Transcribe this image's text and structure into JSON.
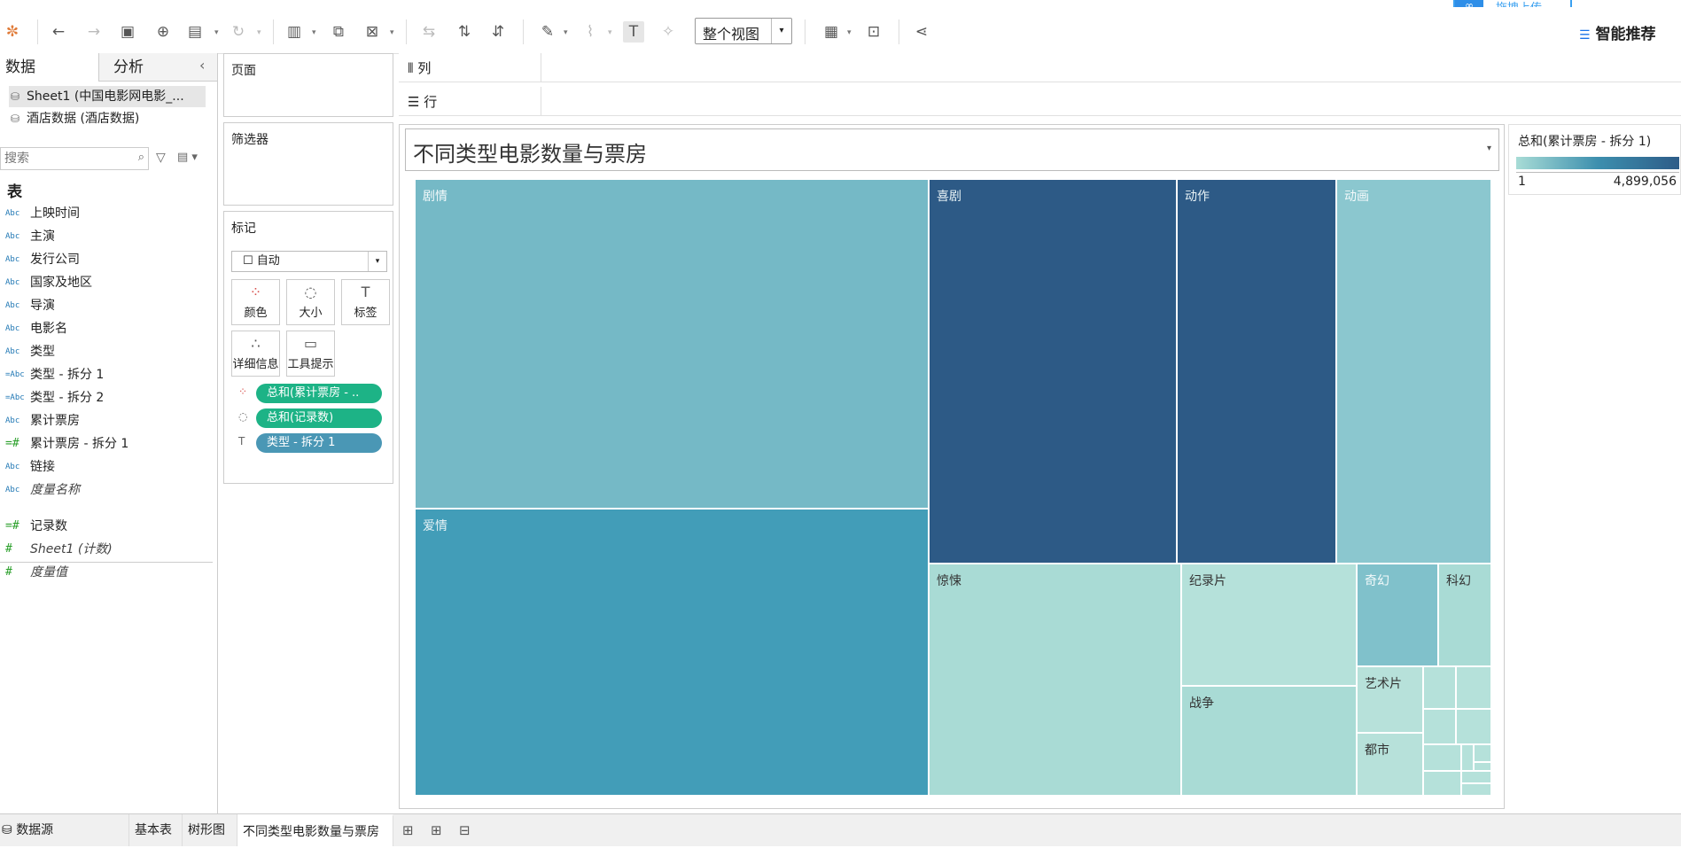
{
  "topbar": {
    "upload_label": "拖拽上传",
    "smart_recommend": "智能推荐",
    "view_select": "整个视图"
  },
  "left_pane": {
    "tab_data": "数据",
    "tab_analysis": "分析",
    "datasources": [
      "Sheet1 (中国电影网电影_...",
      "酒店数据 (酒店数据)"
    ],
    "search_placeholder": "搜索",
    "table_heading": "表",
    "dimensions": [
      {
        "type": "Abc",
        "name": "上映时间"
      },
      {
        "type": "Abc",
        "name": "主演"
      },
      {
        "type": "Abc",
        "name": "发行公司"
      },
      {
        "type": "Abc",
        "name": "国家及地区"
      },
      {
        "type": "Abc",
        "name": "导演"
      },
      {
        "type": "Abc",
        "name": "电影名"
      },
      {
        "type": "Abc",
        "name": "类型"
      },
      {
        "type": "=Abc",
        "name": "类型 - 拆分 1"
      },
      {
        "type": "=Abc",
        "name": "类型 - 拆分 2"
      },
      {
        "type": "Abc",
        "name": "累计票房"
      },
      {
        "type": "=#",
        "name": "累计票房 - 拆分 1"
      },
      {
        "type": "Abc",
        "name": "链接"
      },
      {
        "type": "Abc",
        "name": "度量名称"
      }
    ],
    "measures": [
      {
        "type": "=#",
        "name": "记录数"
      },
      {
        "type": "#",
        "name": "Sheet1 (计数)"
      },
      {
        "type": "#",
        "name": "度量值"
      }
    ]
  },
  "shelves": {
    "pages": "页面",
    "filters": "筛选器",
    "marks": "标记",
    "mark_type": "自动",
    "columns": "列",
    "rows": "行"
  },
  "mark_buttons": [
    {
      "label": "颜色",
      "icon": "color-icon"
    },
    {
      "label": "大小",
      "icon": "size-icon"
    },
    {
      "label": "标签",
      "icon": "label-icon"
    },
    {
      "label": "详细信息",
      "icon": "detail-icon"
    },
    {
      "label": "工具提示",
      "icon": "tooltip-icon"
    }
  ],
  "pills": [
    {
      "label": "总和(累计票房 - ..",
      "icon": "color-dots-icon",
      "color": "#1db386"
    },
    {
      "label": "总和(记录数)",
      "icon": "size-icon",
      "color": "#1db386"
    },
    {
      "label": "类型 - 拆分 1",
      "icon": "label-icon",
      "color": "#4a97b5"
    }
  ],
  "sheet_title": "不同类型电影数量与票房",
  "legend": {
    "title": "总和(累计票房 - 拆分 1)",
    "min": "1",
    "max": "4,899,056"
  },
  "chart_data": {
    "type": "treemap",
    "title": "不同类型电影数量与票房",
    "size_measure": "总和(记录数)",
    "color_measure": "总和(累计票房 - 拆分 1)",
    "label_field": "类型 - 拆分 1",
    "items": [
      {
        "label": "剧情",
        "color": "#75b9c6"
      },
      {
        "label": "爱情",
        "color": "#429db8"
      },
      {
        "label": "喜剧",
        "color": "#2d5a86"
      },
      {
        "label": "动作",
        "color": "#2d5a86"
      },
      {
        "label": "动画",
        "color": "#8bc7cf"
      },
      {
        "label": "惊悚",
        "color": "#a9dbd5"
      },
      {
        "label": "纪录片",
        "color": "#b5e1da"
      },
      {
        "label": "战争",
        "color": "#a9dbd5"
      },
      {
        "label": "奇幻",
        "color": "#80c1cb"
      },
      {
        "label": "科幻",
        "color": "#a9dbd5"
      },
      {
        "label": "艺术片",
        "color": "#b7e1da"
      },
      {
        "label": "都市",
        "color": "#b7e1da"
      }
    ]
  },
  "bottom_tabs": {
    "datasource": "数据源",
    "sheets": [
      "基本表",
      "树形图",
      "不同类型电影数量与票房"
    ]
  }
}
